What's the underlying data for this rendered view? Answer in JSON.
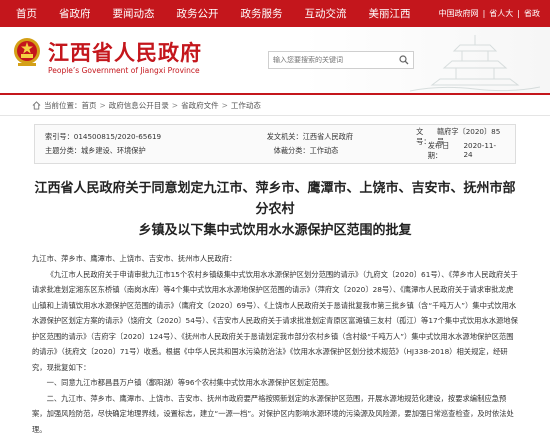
{
  "nav": {
    "items": [
      "首页",
      "省政府",
      "要闻动态",
      "政务公开",
      "政务服务",
      "互动交流",
      "美丽江西"
    ],
    "right": [
      "中国政府网",
      "|",
      "省人大",
      "|",
      "省政"
    ]
  },
  "header": {
    "title": "江西省人民政府",
    "subtitle": "People’s Government of Jiangxi Province",
    "search_placeholder": "输入您要搜索的关键词"
  },
  "breadcrumb": [
    "首页",
    "政府信息公开目录",
    "省政府文件",
    "工作动态"
  ],
  "meta": {
    "rows": [
      [
        [
          "索引号：",
          "014500815/2020-65619"
        ],
        [
          "",
          ""
        ],
        [
          "发文机关：",
          "江西省人民政府"
        ],
        [
          "文号：",
          "赣府字〔2020〕85号"
        ]
      ],
      [
        [
          "主题分类：",
          "城乡建设、环境保护"
        ],
        [
          "",
          ""
        ],
        [
          "体裁分类：",
          "工作动态"
        ],
        [
          "发布日期：",
          "2020-11-24"
        ]
      ]
    ]
  },
  "document": {
    "title_line1": "江西省人民政府关于同意划定九江市、萍乡市、鹰潭市、上饶市、吉安市、抚州市部分农村",
    "title_line2": "乡镇及以下集中式饮用水水源保护区范围的批复",
    "addressee": "九江市、萍乡市、鹰潭市、上饶市、吉安市、抚州市人民政府：",
    "paragraphs": [
      "《九江市人民政府关于申请审批九江市15个农村乡镇级集中式饮用水水源保护区划分范围的请示》（九府文〔2020〕61号）、《萍乡市人民政府关于请求批准划定湘东区东桥镇（南岗水库）等4个集中式饮用水水源地保护区范围的请示》（萍府文〔2020〕28号）、《鹰潭市人民政府关于请求审批龙虎山镇和上清镇饮用水水源保护区范围的请示》（鹰府文〔2020〕69号）、《上饶市人民政府关于恳请批复我市第三批乡镇（含“千吨万人”）集中式饮用水水源保护区划定方案的请示》（饶府文〔2020〕54号）、《吉安市人民政府关于请求批准划定青原区富滩镇三友村（孤江）等17个集中式饮用水水源地保护区范围的请示》（吉府字〔2020〕124号）、《抚州市人民政府关于恳请划定我市部分农村乡镇（含村级“千吨万人”）集中式饮用水水源地保护区范围的请示》（抚府文〔2020〕71号）收悉。根据《中华人民共和国水污染防治法》《饮用水水源保护区划分技术规范》（HJ338-2018）相关规定，经研究，现批复如下：",
      "一、同意九江市都昌县万户镇（鄱阳湖）等96个农村集中式饮用水水源保护区划定范围。",
      "二、九江市、萍乡市、鹰潭市、上饶市、吉安市、抚州市政府要严格按照新划定的水源保护区范围，开展水源地规范化建设，按要求编制应急预案，加强风险防范，尽快确定地理界线，设置标志，建立“一源一档”。对保护区内影响水源环境的污染源及风险源，要加强日常巡查检查，及时依法处理。"
    ]
  }
}
